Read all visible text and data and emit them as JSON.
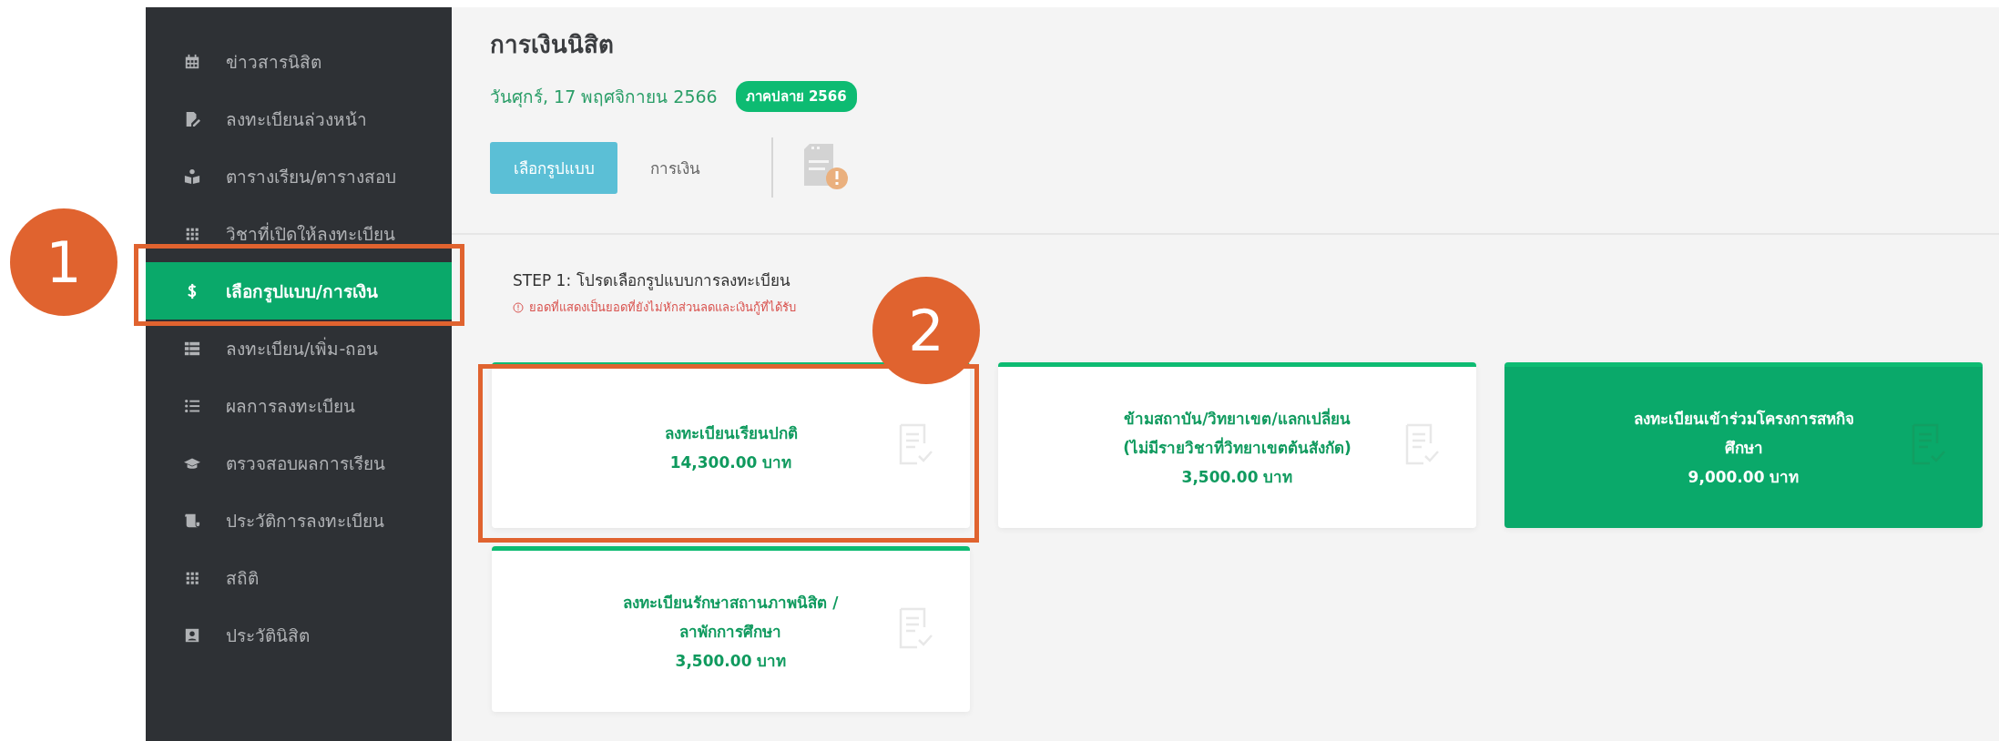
{
  "sidebar": {
    "items": [
      {
        "label": "ข่าวสารนิสิต",
        "selected": false
      },
      {
        "label": "ลงทะเบียนล่วงหน้า",
        "selected": false
      },
      {
        "label": "ตารางเรียน/ตารางสอบ",
        "selected": false
      },
      {
        "label": "วิชาที่เปิดให้ลงทะเบียน",
        "selected": false
      },
      {
        "label": "เลือกรูปแบบ/การเงิน",
        "selected": true
      },
      {
        "label": "ลงทะเบียน/เพิ่ม-ถอน",
        "selected": false
      },
      {
        "label": "ผลการลงทะเบียน",
        "selected": false
      },
      {
        "label": "ตรวจสอบผลการเรียน",
        "selected": false
      },
      {
        "label": "ประวัติการลงทะเบียน",
        "selected": false
      },
      {
        "label": "สถิติ",
        "selected": false
      },
      {
        "label": "ประวัตินิสิต",
        "selected": false
      }
    ]
  },
  "header": {
    "title": "การเงินนิสิต",
    "date": "วันศุกร์, 17 พฤศจิกายน 2566",
    "term_badge": "ภาคปลาย 2566"
  },
  "tabs": [
    {
      "label": "เลือกรูปแบบ",
      "selected": true
    },
    {
      "label": "การเงิน",
      "selected": false
    }
  ],
  "step": {
    "title": "STEP 1: โปรดเลือกรูปแบบการลงทะเบียน",
    "warning": "ยอดที่แสดงเป็นยอดที่ยังไม่หักส่วนลดและเงินกู้ที่ได้รับ"
  },
  "options": [
    {
      "lines": [
        "ลงทะเบียนเรียนปกติ"
      ],
      "amount": "14,300.00 บาท",
      "selected": false
    },
    {
      "lines": [
        "ข้ามสถาบัน/วิทยาเขต/แลกเปลี่ยน",
        "(ไม่มีรายวิชาที่วิทยาเขตต้นสังกัด)"
      ],
      "amount": "3,500.00 บาท",
      "selected": false
    },
    {
      "lines": [
        "ลงทะเบียนเข้าร่วมโครงการสหกิจ",
        "ศึกษา"
      ],
      "amount": "9,000.00 บาท",
      "selected": true
    },
    {
      "lines": [
        "ลงทะเบียนรักษาสถานภาพนิสิต /",
        "ลาพักการศึกษา"
      ],
      "amount": "3,500.00 บาท",
      "selected": false
    }
  ],
  "annotations": [
    {
      "label": "1"
    },
    {
      "label": "2"
    }
  ]
}
